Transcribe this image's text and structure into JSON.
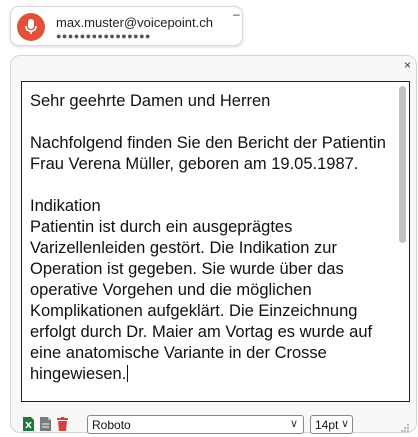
{
  "login": {
    "email": "max.muster@voicepoint.ch",
    "password_mask": "●●●●●●●●●●●●●●●●",
    "minimize_label": "–"
  },
  "panel": {
    "close_label": "×"
  },
  "editor": {
    "text": "Sehr geehrte Damen und Herren\n\nNachfolgend finden Sie den Bericht der Patientin Frau Verena Müller, geboren am 19.05.1987.\n\nIndikation\nPatientin ist durch ein ausgeprägtes Varizellenleiden gestört. Die Indikation zur Operation ist gegeben. Sie wurde über das operative Vorgehen und die möglichen Komplikationen aufgeklärt. Die Einzeichnung erfolgt durch Dr. Maier am Vortag es wurde auf eine anatomische Variante in der Crosse hingewiesen.",
    "scroll_position": 0.0
  },
  "toolbar": {
    "font_value": "Roboto",
    "size_value": "14pt",
    "icons": [
      "excel-export-icon",
      "document-icon",
      "trash-icon"
    ],
    "chevron": "∨"
  },
  "colors": {
    "brand_red": "#e0513a",
    "excel_green": "#1e7a3c",
    "trash_red": "#d9403a",
    "doc_gray": "#7a7a7a"
  }
}
